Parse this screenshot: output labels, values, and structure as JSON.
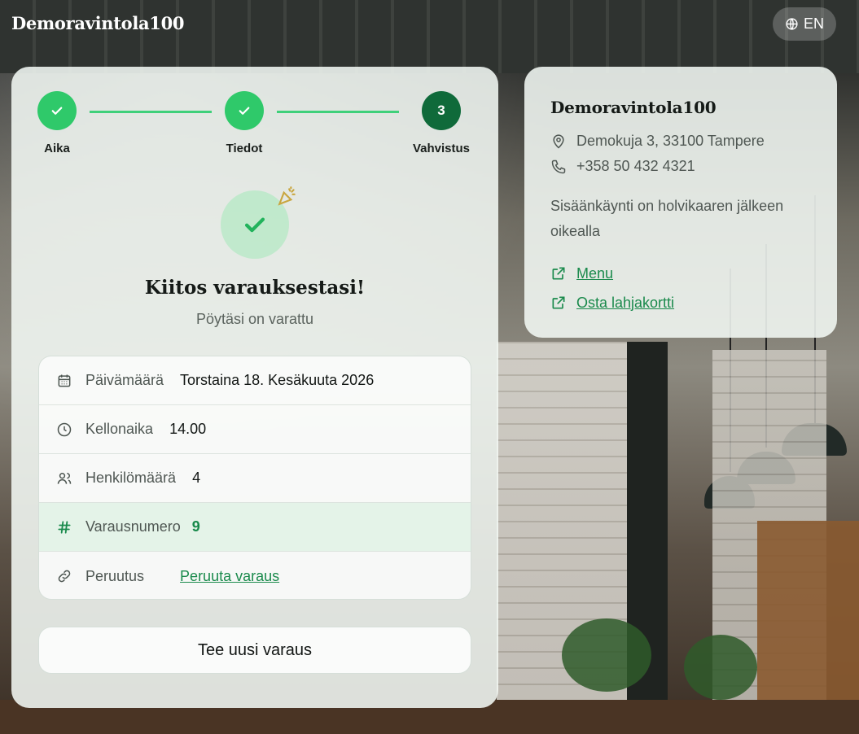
{
  "header": {
    "brand": "Demoravintola100",
    "language": "EN"
  },
  "stepper": {
    "steps": [
      {
        "label": "Aika",
        "state": "done"
      },
      {
        "label": "Tiedot",
        "state": "done"
      },
      {
        "label": "Vahvistus",
        "state": "active",
        "number": "3"
      }
    ]
  },
  "confirmation": {
    "title": "Kiitos varauksestasi!",
    "subtitle": "Pöytäsi on varattu",
    "details": {
      "date_label": "Päivämäärä",
      "date_value": "Torstaina 18. Kesäkuuta 2026",
      "time_label": "Kellonaika",
      "time_value": "14.00",
      "guests_label": "Henkilömäärä",
      "guests_value": "4",
      "reservation_label": "Varausnumero",
      "reservation_value": "9",
      "cancel_label": "Peruutus",
      "cancel_link": "Peruuta varaus"
    },
    "new_booking_button": "Tee uusi varaus"
  },
  "restaurant": {
    "name": "Demoravintola100",
    "address": "Demokuja 3, 33100 Tampere",
    "phone": "+358 50 432 4321",
    "note": "Sisäänkäynti on holvikaaren jälkeen oikealla",
    "links": [
      "Menu",
      "Osta lahjakortti"
    ]
  },
  "colors": {
    "accent": "#2fc96a",
    "accent_dark": "#0f6a3a",
    "link": "#1a8a4c"
  }
}
